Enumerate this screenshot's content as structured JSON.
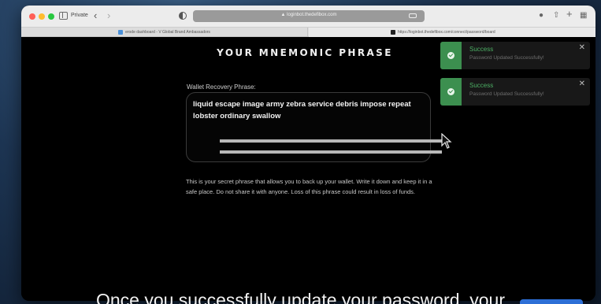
{
  "browser": {
    "private_label": "Private",
    "back_icon": "chevron-left-icon",
    "forward_icon": "chevron-right-icon",
    "address": "▲ loginbot.thedefibox.com",
    "tabs": [
      {
        "label": "erode dashboard - V Global Brand Ambassadors"
      },
      {
        "label": "https://loginbot.thedefibox.com/connect/password/board"
      }
    ]
  },
  "page": {
    "title": "YOUR MNEMONIC PHRASE",
    "phrase_label": "Wallet Recovery Phrase:",
    "phrase": "liquid escape image army zebra service debris impose repeat lobster ordinary swallow",
    "description": "This is your secret phrase that allows you to back up your wallet. Write it down and keep it in a safe place. Do not share it with anyone. Loss of this phrase could result in loss of funds."
  },
  "toasts": [
    {
      "title": "Success",
      "message": "Password Updated Successfully!",
      "close": "✕"
    },
    {
      "title": "Success",
      "message": "Password Updated Successfully!",
      "close": "✕"
    }
  ],
  "caption": "Once you successfully update your password, your",
  "colors": {
    "success": "#3c8f4f",
    "background": "#000000"
  }
}
